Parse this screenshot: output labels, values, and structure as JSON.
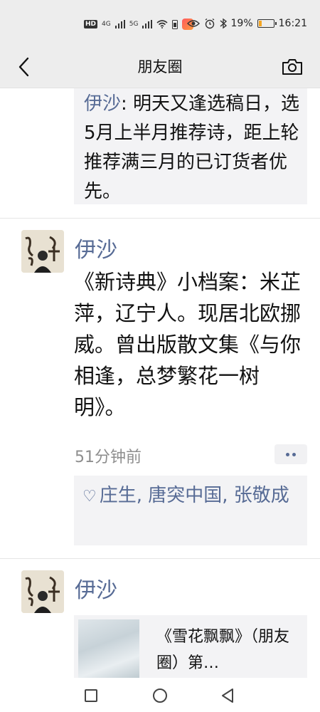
{
  "status_bar": {
    "hd_label": "HD",
    "signal1_label": "4G",
    "signal2_label": "5G",
    "battery_percent": "19%",
    "battery_level": 0.19,
    "time": "16:21",
    "battery_color": "#f5a623"
  },
  "header": {
    "title": "朋友圈",
    "back_icon": "back-chevron-icon",
    "camera_icon": "camera-icon"
  },
  "feed": {
    "prev_comment": {
      "author": "伊沙",
      "text": ": 明天又逢选稿日，选5月上半月推荐诗，距上轮推荐满三月的已订货者优先。"
    },
    "posts": [
      {
        "username": "伊沙",
        "text": "《新诗典》小档案：米芷萍，辽宁人。现居北欧挪威。曾出版散文集《与你相逢，总梦繁花一树明》。",
        "timestamp": "51分钟前",
        "likes_icon": "heart-icon",
        "likes": "庄生, 唐突中国, 张敬成"
      },
      {
        "username": "伊沙",
        "share_title": "《雪花飘飘》（朋友圈）第…"
      }
    ]
  },
  "colors": {
    "link_blue": "#576b95",
    "bar_gray": "#ededed",
    "box_gray": "#f3f3f5"
  }
}
